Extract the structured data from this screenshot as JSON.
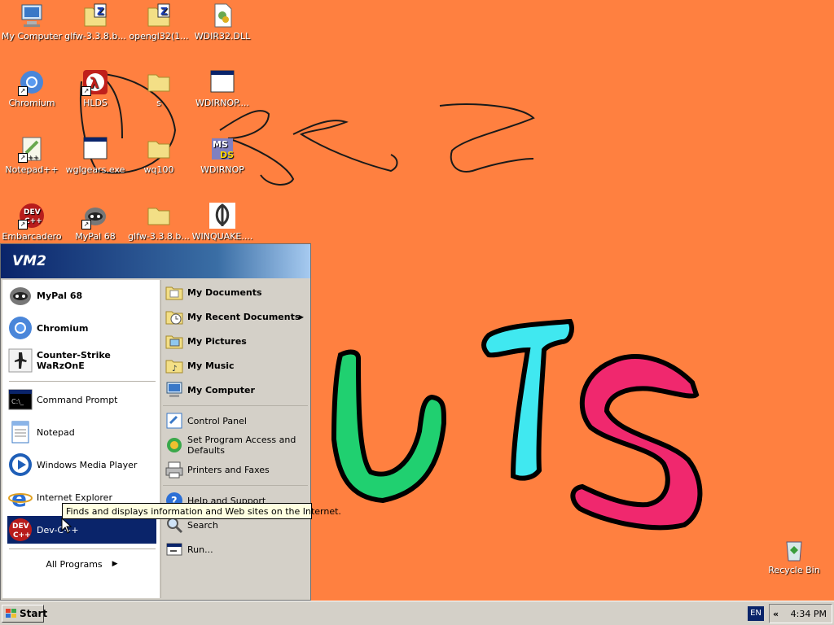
{
  "desktop": {
    "background_color": "#ff8040",
    "icons": [
      {
        "label": "My Computer",
        "icon": "my-computer-icon"
      },
      {
        "label": "glfw-3.3.8.b...",
        "icon": "zip-folder-icon"
      },
      {
        "label": "opengl32(1...",
        "icon": "zip-folder-icon"
      },
      {
        "label": "WDIR32.DLL",
        "icon": "dll-file-icon"
      },
      {
        "label": "Chromium",
        "icon": "chromium-icon"
      },
      {
        "label": "HLDS",
        "icon": "half-life-icon"
      },
      {
        "label": "s",
        "icon": "folder-icon"
      },
      {
        "label": "WDIRNOP....",
        "icon": "window-app-icon"
      },
      {
        "label": "Notepad++",
        "icon": "notepadpp-icon"
      },
      {
        "label": "wglgears.exe",
        "icon": "window-app-icon"
      },
      {
        "label": "wq100",
        "icon": "folder-icon"
      },
      {
        "label": "WDIRNOP",
        "icon": "msdos-icon"
      },
      {
        "label": "Embarcadero",
        "icon": "devcpp-icon"
      },
      {
        "label": "MyPal 68",
        "icon": "mypal-icon"
      },
      {
        "label": "glfw-3.3.8.b...",
        "icon": "folder-icon"
      },
      {
        "label": "WINQUAKE....",
        "icon": "quake-icon"
      },
      {
        "label": "Recycle Bin",
        "icon": "recycle-bin-icon"
      }
    ]
  },
  "start_menu": {
    "user": "VM2",
    "pinned": [
      {
        "label": "MyPal 68",
        "icon": "mypal-icon"
      },
      {
        "label": "Chromium",
        "icon": "chromium-icon"
      },
      {
        "label": "Counter-Strike WaRzOnE",
        "icon": "counter-strike-icon"
      }
    ],
    "recent": [
      {
        "label": "Command Prompt",
        "icon": "command-prompt-icon"
      },
      {
        "label": "Notepad",
        "icon": "notepad-icon"
      },
      {
        "label": "Windows Media Player",
        "icon": "media-player-icon"
      },
      {
        "label": "Internet Explorer",
        "icon": "internet-explorer-icon"
      },
      {
        "label": "Dev-C++",
        "icon": "devcpp-icon"
      }
    ],
    "all_programs": "All Programs",
    "right_bold": [
      {
        "label": "My Documents",
        "icon": "my-documents-icon"
      },
      {
        "label": "My Recent Documents",
        "icon": "recent-documents-icon"
      },
      {
        "label": "My Pictures",
        "icon": "my-pictures-icon"
      },
      {
        "label": "My Music",
        "icon": "my-music-icon"
      },
      {
        "label": "My Computer",
        "icon": "my-computer-icon"
      }
    ],
    "right_normal": [
      {
        "label": "Control Panel",
        "icon": "control-panel-icon"
      },
      {
        "label": "Set Program Access and Defaults",
        "icon": "program-access-icon"
      },
      {
        "label": "Printers and Faxes",
        "icon": "printer-icon"
      },
      {
        "label": "Help and Support",
        "icon": "help-icon"
      },
      {
        "label": "Search",
        "icon": "search-icon"
      },
      {
        "label": "Run...",
        "icon": "run-icon"
      }
    ],
    "set_program_line1": "Set Program Access and",
    "set_program_line2": "Defaults"
  },
  "tooltip": "Finds and displays information and Web sites on the Internet.",
  "taskbar": {
    "start_label": "Start",
    "language": "EN",
    "chevron": "«",
    "time": "4:34 PM"
  },
  "colors": {
    "selection": "#0a246a",
    "menu_face": "#d4d0c8",
    "wallpaper": "#ff8040"
  }
}
